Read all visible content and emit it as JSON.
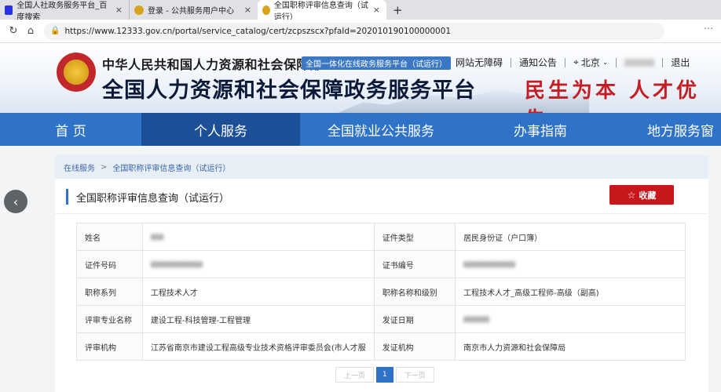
{
  "browser": {
    "tabs": [
      {
        "title": "全国人社政务服务平台_百度搜索",
        "close": "×"
      },
      {
        "title": "登录 - 公共服务用户中心",
        "close": "×"
      },
      {
        "title": "全国职称评审信息查询（试运行）",
        "close": "×"
      }
    ],
    "new_tab": "+",
    "url": "https://www.12333.gov.cn/portal/service_catalog/cert/zcpszscx?pfaId=202010190100000001"
  },
  "header": {
    "ministry": "中华人民共和国人力资源和社会保障部",
    "tagline_badge": "全国一体化在线政务服务平台（试运行）",
    "platform_title": "全国人力资源和社会保障政务服务平台",
    "slogan": "民生为本  人才优先",
    "links": {
      "accessibility": "网站无障碍",
      "notices": "通知公告",
      "location": "北京",
      "user": "",
      "logout": "退出"
    }
  },
  "nav": {
    "items": [
      "首 页",
      "个人服务",
      "全国就业公共服务",
      "办事指南",
      "地方服务窗"
    ],
    "active_index": 1
  },
  "content": {
    "breadcrumb": {
      "home": "在线服务",
      "sep": ">",
      "current": "全国职称评审信息查询（试运行）"
    },
    "section_title": "全国职称评审信息查询（试运行）",
    "favorite_label": "收藏",
    "rows": [
      {
        "l1": "姓名",
        "v1": "▮▮▮",
        "l2": "证件类型",
        "v2": "居民身份证（户口簿）"
      },
      {
        "l1": "证件号码",
        "v1": "▮▮▮▮▮▮▮▮▮▮▮▮",
        "l2": "证书编号",
        "v2": "▮▮▮▮▮▮▮▮▮▮▮▮"
      },
      {
        "l1": "职称系列",
        "v1": "工程技术人才",
        "l2": "职称名称和级别",
        "v2": "工程技术人才_高级工程师-高级（副高)"
      },
      {
        "l1": "评审专业名称",
        "v1": "建设工程-科技管理-工程管理",
        "l2": "发证日期",
        "v2": "▮▮▮▮▮▮"
      },
      {
        "l1": "评审机构",
        "v1": "江苏省南京市建设工程高级专业技术资格评审委员会(市人才服",
        "l2": "发证机构",
        "v2": "南京市人力资源和社会保障局"
      }
    ],
    "pager": {
      "prev": "上一页",
      "current": "1",
      "next": "下一页"
    }
  }
}
